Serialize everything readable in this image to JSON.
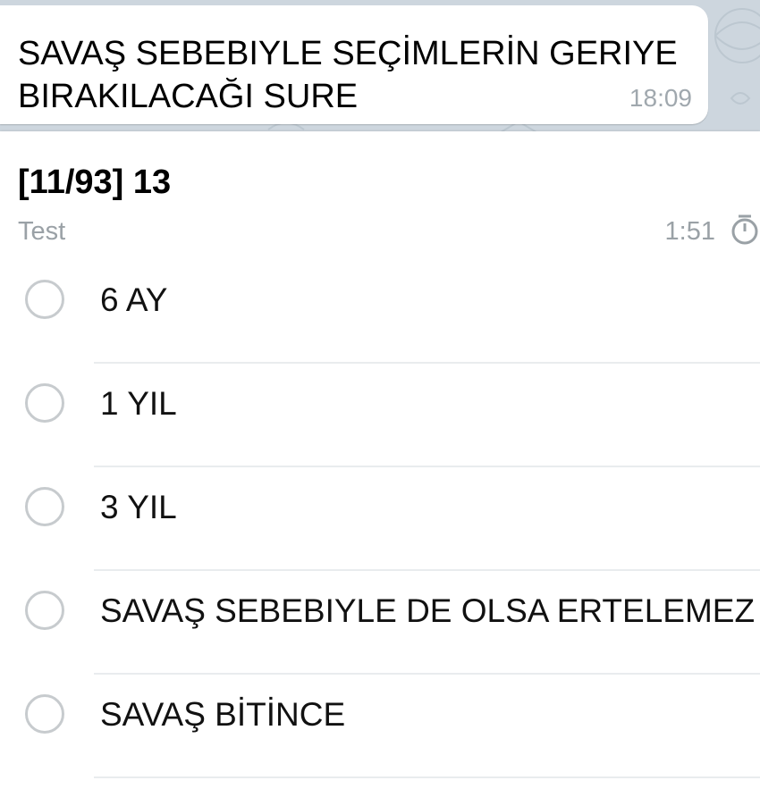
{
  "message": {
    "text": "SAVAŞ SEBEBIYLE SEÇİMLERİN GERIYE BIRAKILACAĞI SURE",
    "time": "18:09"
  },
  "quiz": {
    "title": "[11/93] 13",
    "type": "Test",
    "timer": "1:51",
    "timer_icon": "stopwatch-icon",
    "options": [
      {
        "label": "6 AY"
      },
      {
        "label": "1 YIL"
      },
      {
        "label": "3 YIL"
      },
      {
        "label": "SAVAŞ SEBEBIYLE DE OLSA ERTELEMEZ"
      },
      {
        "label": "SAVAŞ BİTİNCE"
      }
    ]
  }
}
